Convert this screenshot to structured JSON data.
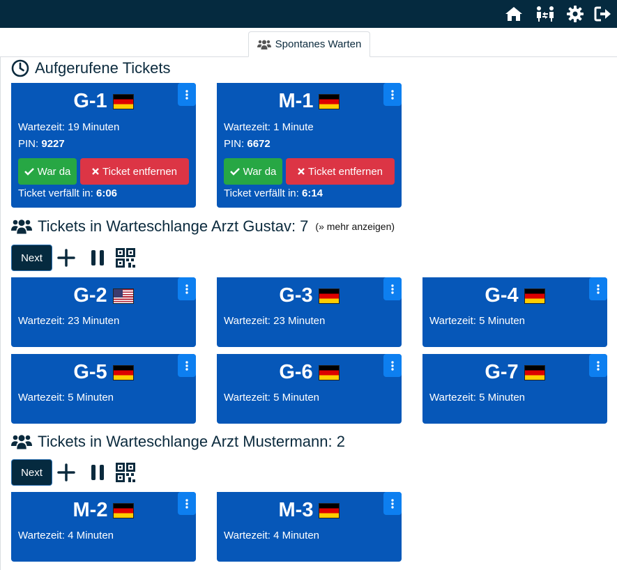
{
  "colors": {
    "topbar": "#052a3f",
    "card": "#0657b8",
    "menu": "#0d7ff0",
    "green": "#27a744",
    "red": "#dc3545"
  },
  "topbar": {
    "icons": [
      "home-icon",
      "people-arrows-icon",
      "gear-icon",
      "sign-out-icon"
    ]
  },
  "tabs": [
    {
      "label": "Spontanes Warten",
      "icon": "users-icon"
    }
  ],
  "called": {
    "title": "Aufgerufene Tickets",
    "tickets": [
      {
        "id": "G-1",
        "flag": "de",
        "wait": "Wartezeit: 19 Minuten",
        "pin_label": "PIN:",
        "pin": "9227",
        "was_there": "War da",
        "remove": "Ticket entfernen",
        "expires_label": "Ticket verfällt in:",
        "expires": "6:06"
      },
      {
        "id": "M-1",
        "flag": "de",
        "wait": "Wartezeit: 1 Minute",
        "pin_label": "PIN:",
        "pin": "6672",
        "was_there": "War da",
        "remove": "Ticket entfernen",
        "expires_label": "Ticket verfällt in:",
        "expires": "6:14"
      }
    ]
  },
  "queues": [
    {
      "title": "Tickets in Warteschlange Arzt Gustav: 7",
      "more": "(» mehr anzeigen)",
      "next_label": "Next",
      "tickets": [
        {
          "id": "G-2",
          "flag": "us",
          "wait": "Wartezeit: 23 Minuten"
        },
        {
          "id": "G-3",
          "flag": "de",
          "wait": "Wartezeit: 23 Minuten"
        },
        {
          "id": "G-4",
          "flag": "de",
          "wait": "Wartezeit: 5 Minuten"
        },
        {
          "id": "G-5",
          "flag": "de",
          "wait": "Wartezeit: 5 Minuten"
        },
        {
          "id": "G-6",
          "flag": "de",
          "wait": "Wartezeit: 5 Minuten"
        },
        {
          "id": "G-7",
          "flag": "de",
          "wait": "Wartezeit: 5 Minuten"
        }
      ]
    },
    {
      "title": "Tickets in Warteschlange Arzt Mustermann: 2",
      "next_label": "Next",
      "tickets": [
        {
          "id": "M-2",
          "flag": "de",
          "wait": "Wartezeit: 4 Minuten"
        },
        {
          "id": "M-3",
          "flag": "de",
          "wait": "Wartezeit: 4 Minuten"
        }
      ]
    }
  ]
}
